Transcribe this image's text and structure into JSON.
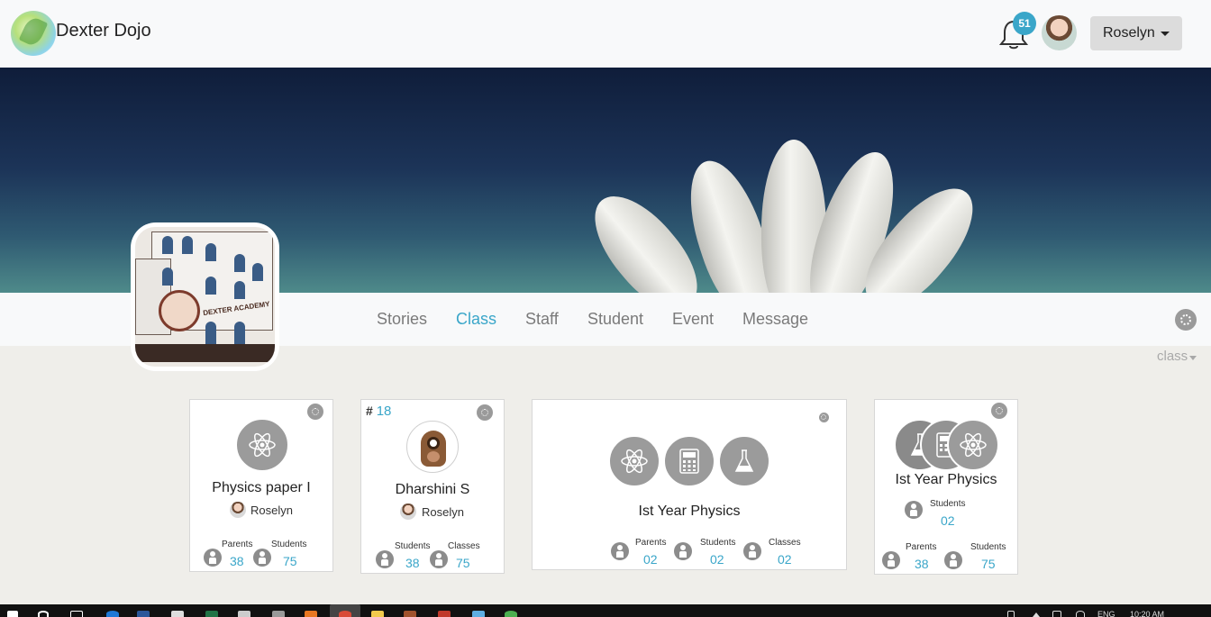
{
  "app": {
    "brand": "Dexter Dojo"
  },
  "header": {
    "notification_count": "51",
    "user_name": "Roselyn"
  },
  "nav": {
    "items": [
      {
        "label": "Stories"
      },
      {
        "label": "Class",
        "active": true
      },
      {
        "label": "Staff"
      },
      {
        "label": "Student"
      },
      {
        "label": "Event"
      },
      {
        "label": "Message"
      }
    ]
  },
  "school": {
    "sign_text": "AFTER-SCHOOL",
    "building_name": "DEXTER ACADEMY"
  },
  "filter": {
    "label": "class"
  },
  "colors": {
    "accent": "#3aa6c9",
    "icon_gray": "#9b9b9b",
    "page_bg": "#efeeea"
  },
  "cards": [
    {
      "title": "Physics paper I",
      "owner": "Roselyn",
      "icons": [
        "atom-icon"
      ],
      "stats": [
        {
          "label": "Parents",
          "value": "38"
        },
        {
          "label": "Students",
          "value": "75"
        }
      ]
    },
    {
      "hash_label": "#",
      "hash_value": "18",
      "title": "Dharshini S",
      "owner": "Roselyn",
      "stats": [
        {
          "label": "Students",
          "value": "38"
        },
        {
          "label": "Classes",
          "value": "75"
        }
      ]
    },
    {
      "title": "Ist Year Physics",
      "icons": [
        "atom-icon",
        "calculator-icon",
        "flask-icon"
      ],
      "stats": [
        {
          "label": "Parents",
          "value": "02"
        },
        {
          "label": "Students",
          "value": "02"
        },
        {
          "label": "Classes",
          "value": "02"
        }
      ]
    },
    {
      "title": "Ist Year Physics",
      "icons": [
        "flask-icon",
        "calculator-icon",
        "atom-icon"
      ],
      "top_stat": {
        "label": "Students",
        "value": "02"
      },
      "stats": [
        {
          "label": "Parents",
          "value": "38"
        },
        {
          "label": "Students",
          "value": "75"
        }
      ]
    }
  ],
  "taskbar": {
    "lang": "ENG",
    "time": "10:20 AM"
  }
}
